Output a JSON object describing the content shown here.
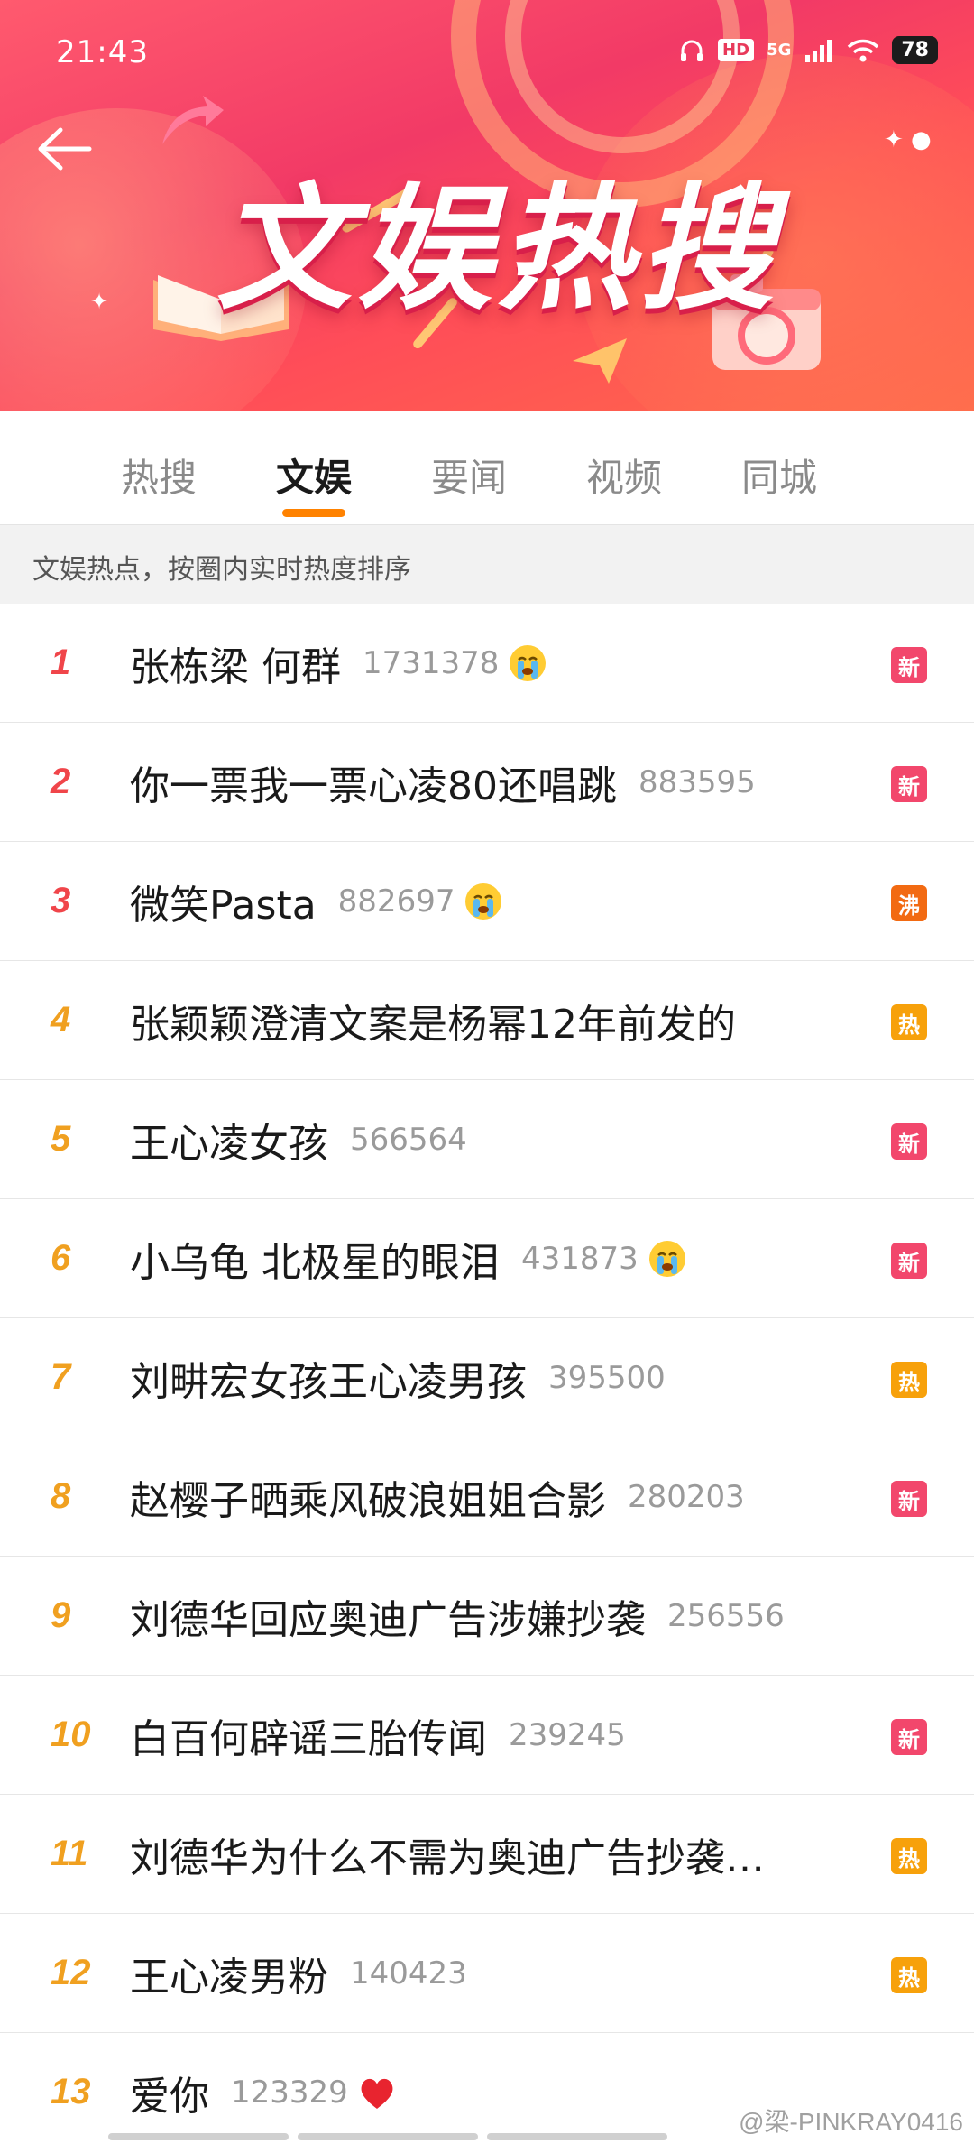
{
  "status_bar": {
    "time": "21:43",
    "network": "5G",
    "hd": "HD",
    "battery": "78"
  },
  "banner": {
    "title": "文娱热搜"
  },
  "tabs": [
    {
      "label": "热搜",
      "active": false
    },
    {
      "label": "文娱",
      "active": true
    },
    {
      "label": "要闻",
      "active": false
    },
    {
      "label": "视频",
      "active": false
    },
    {
      "label": "同城",
      "active": false
    }
  ],
  "subheader": "文娱热点，按圈内实时热度排序",
  "colors": {
    "badge_new": "#f2476c",
    "badge_boil": "#f26a12",
    "badge_hot": "#f7a10b",
    "rank_top": "#f0454a",
    "rank_other": "#f0a020",
    "tab_indicator": "#ff8200"
  },
  "list": [
    {
      "rank": "1",
      "title": "张栋梁 何群",
      "count": "1731378",
      "emoji": "crying-face-icon",
      "badge": "新"
    },
    {
      "rank": "2",
      "title": "你一票我一票心凌80还唱跳",
      "count": "883595",
      "emoji": "",
      "badge": "新"
    },
    {
      "rank": "3",
      "title": "微笑Pasta",
      "count": "882697",
      "emoji": "crying-face-icon",
      "badge": "沸"
    },
    {
      "rank": "4",
      "title": "张颖颖澄清文案是杨幂12年前发的",
      "count": "",
      "emoji": "",
      "badge": "热"
    },
    {
      "rank": "5",
      "title": "王心凌女孩",
      "count": "566564",
      "emoji": "",
      "badge": "新"
    },
    {
      "rank": "6",
      "title": "小乌龟 北极星的眼泪",
      "count": "431873",
      "emoji": "crying-face-icon",
      "badge": "新"
    },
    {
      "rank": "7",
      "title": "刘畊宏女孩王心凌男孩",
      "count": "395500",
      "emoji": "",
      "badge": "热"
    },
    {
      "rank": "8",
      "title": "赵樱子晒乘风破浪姐姐合影",
      "count": "280203",
      "emoji": "",
      "badge": "新"
    },
    {
      "rank": "9",
      "title": "刘德华回应奥迪广告涉嫌抄袭",
      "count": "256556",
      "emoji": "",
      "badge": ""
    },
    {
      "rank": "10",
      "title": "白百何辟谣三胎传闻",
      "count": "239245",
      "emoji": "",
      "badge": "新"
    },
    {
      "rank": "11",
      "title": "刘德华为什么不需为奥迪广告抄袭…",
      "count": "",
      "emoji": "",
      "badge": "热"
    },
    {
      "rank": "12",
      "title": "王心凌男粉",
      "count": "140423",
      "emoji": "",
      "badge": "热"
    },
    {
      "rank": "13",
      "title": "爱你",
      "count": "123329",
      "emoji": "heart-icon",
      "badge": ""
    }
  ],
  "watermark": "@梁-PINKRAY0416"
}
